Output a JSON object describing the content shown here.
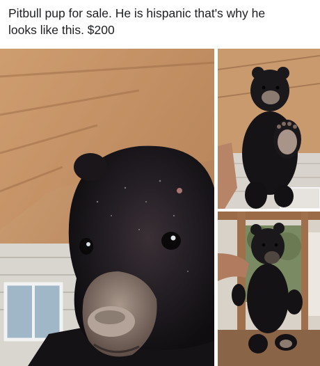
{
  "post": {
    "caption_line1": "Pitbull pup for sale. He is hispanic that's why he",
    "caption_line2": "looks like this. $200"
  },
  "photos": [
    {
      "name": "bear-cub-closeup-photo"
    },
    {
      "name": "bear-cub-held-up-photo"
    },
    {
      "name": "bear-cub-on-porch-photo"
    }
  ],
  "colors": {
    "wood_ceiling": "#c79569",
    "fur": "#151318",
    "muzzle": "#8c7a6d",
    "siding": "#dcd8d2"
  }
}
